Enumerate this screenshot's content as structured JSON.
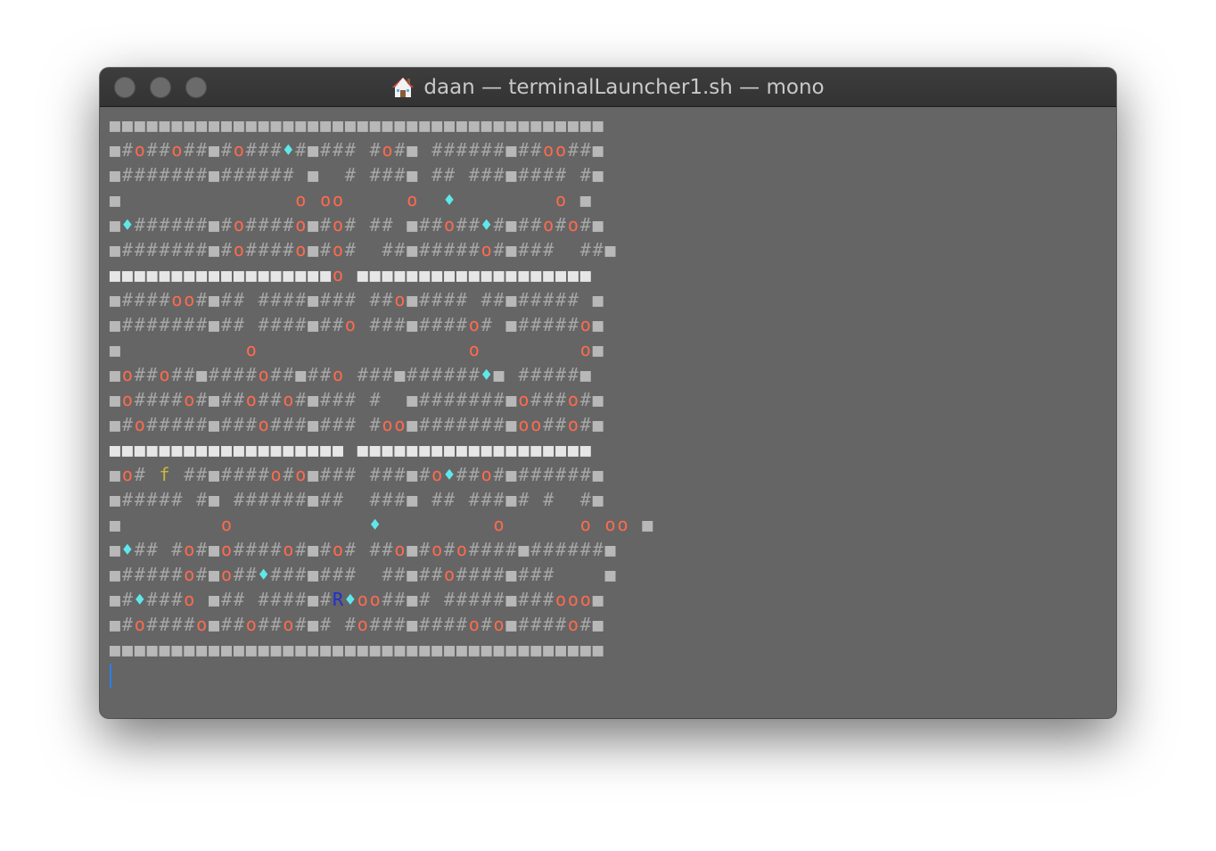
{
  "window": {
    "title": "daan — terminalLauncher1.sh — mono",
    "title_icon": "home-icon"
  },
  "colors": {
    "wall": "#a6a6a6",
    "block": "#b8b8b8",
    "coin_o": "#ff6a4d",
    "diamond": "#5fe8ea",
    "f": "#c9b838",
    "R": "#1f2fd0",
    "background": "#656565"
  },
  "terminal": {
    "lines": [
      "■■■■■■■■■■■■■■■■■■■■■■■■■■■■■■■■■■■■■■■■",
      "■#o##o##■#o###♦#■### #o#■ ######■##oo##■",
      "■#######■###### ■  # ###■ ## ###■#### #■",
      "■              o oo     o  ♦        o ■",
      "■♦######■#o####o■#o# ## ■##o##♦#■##o#o#■",
      "■#######■#o####o■#o#  ##■#####o#■###  ##■",
      "■■■■■■■■■■■■■■■■■■o ■■■■■■■■■■■■■■■■■■■",
      "■####oo#■## ####■### ##o■#### ##■##### ■",
      "■#######■## ####■##o ###■####o# ■#####o■",
      "■          o                 o        o■",
      "■o##o##■####o##■##o ###■######♦■ #####■",
      "■o####o#■##o##o#■### #  ■#######■o###o#■",
      "■#o#####■###o###■### #oo■#######■oo##o#■",
      "■■■■■■■■■■■■■■■■■■■ ■■■■■■■■■■■■■■■■■■■",
      "■o# f ##■####o#o■### ###■#o♦##o#■######■",
      "■##### #■ ######■##  ###■ ## ###■# #  #■",
      "■        o           ♦         o      o oo ■",
      "■♦## #o#■o####o#■#o# ##o■#o#o####■######■",
      "■#####o#■o##♦###■###  ##■##o####■###    ■",
      "■#♦###o ■## ####■#R♦oo##■# #####■###ooo■",
      "■#o####o■##o##o#■# #o###■####o#o■####o#■",
      "■■■■■■■■■■■■■■■■■■■■■■■■■■■■■■■■■■■■■■■■"
    ]
  }
}
